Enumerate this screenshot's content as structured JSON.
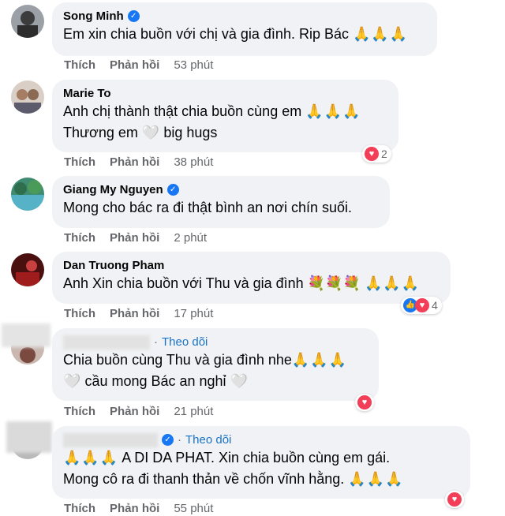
{
  "comments": [
    {
      "name": "Song Minh",
      "verified": true,
      "lines": [
        {
          "text": "Em xin chia buồn với chị và gia đình. Rip Bác",
          "emoji": "🙏🙏🙏"
        }
      ],
      "actions": {
        "like": "Thích",
        "reply": "Phản hồi",
        "time": "53 phút"
      }
    },
    {
      "name": "Marie To",
      "lines": [
        {
          "text": "Anh chị thành thật chia buồn cùng em",
          "emoji": "🙏🙏🙏"
        },
        {
          "text": "Thương em",
          "heart": "🤍",
          "text2": "big hugs"
        }
      ],
      "actions": {
        "like": "Thích",
        "reply": "Phản hồi",
        "time": "38 phút"
      },
      "reactions": {
        "count": "2"
      }
    },
    {
      "name": "Giang My Nguyen",
      "verified": true,
      "lines": [
        {
          "text": "Mong cho bác ra đi thật bình an nơi chín suối."
        }
      ],
      "actions": {
        "like": "Thích",
        "reply": "Phản hồi",
        "time": "2 phút"
      }
    },
    {
      "name": "Dan Truong Pham",
      "lines": [
        {
          "text": "Anh Xin chia buồn với Thu và gia đình",
          "flowers": "💐💐💐",
          "emoji": "🙏🙏🙏"
        }
      ],
      "actions": {
        "like": "Thích",
        "reply": "Phản hồi",
        "time": "17 phút"
      },
      "reactions": {
        "count": "4"
      }
    },
    {
      "name_suffix": "Theo dõi",
      "lines": [
        {
          "text": "Chia buồn cùng Thu và gia đình nhe",
          "emoji": "🙏🙏🙏"
        },
        {
          "heart": "🤍",
          "text": "cầu mong Bác an nghỉ",
          "heart2": "🤍"
        }
      ],
      "actions": {
        "like": "Thích",
        "reply": "Phản hồi",
        "time": "21 phút"
      }
    },
    {
      "name_suffix": "Theo dõi",
      "verified": true,
      "lines": [
        {
          "emoji": "🙏🙏🙏",
          "text": "A DI DA PHAT. Xin chia buồn cùng em gái."
        },
        {
          "text": "Mong cô ra đi thanh thản về chốn vĩnh hằng.",
          "emoji": "🙏🙏🙏"
        }
      ],
      "actions": {
        "like": "Thích",
        "reply": "Phản hồi",
        "time": "55 phút"
      }
    }
  ],
  "colors": {
    "bubble": "#f0f2f5",
    "verified": "#1877f2",
    "follow": "#1a73c7",
    "love": "#f33e58",
    "meta": "#65676b"
  }
}
